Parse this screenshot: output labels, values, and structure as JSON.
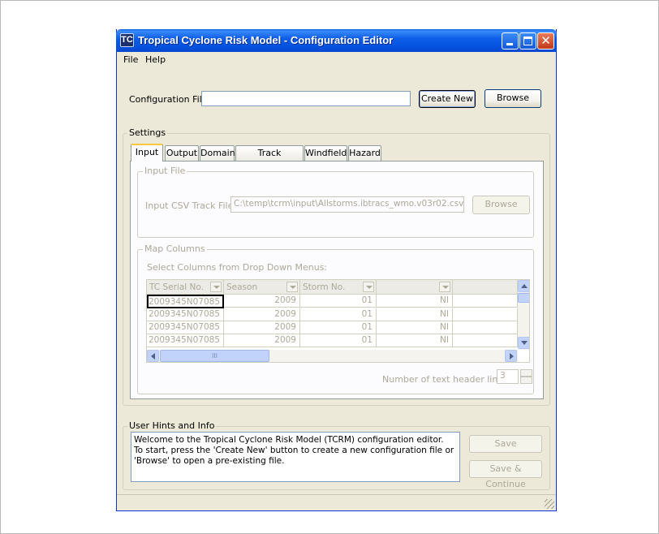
{
  "window": {
    "title": "Tropical Cyclone Risk Model - Configuration Editor",
    "icon_text": "TC"
  },
  "menu": [
    "File",
    "Help"
  ],
  "config": {
    "label": "Configuration File:",
    "value": "",
    "create_new_label": "Create New",
    "browse_label": "Browse"
  },
  "settings": {
    "title": "Settings",
    "tabs": [
      "Input",
      "Output",
      "Domain",
      "Track Generator",
      "Windfield",
      "Hazard"
    ],
    "active_tab": "Input",
    "input_file": {
      "title": "Input File",
      "label": "Input CSV Track File:",
      "value": "C:\\temp\\tcrm\\input\\Allstorms.ibtracs_wmo.v03r02.csv",
      "browse_label": "Browse"
    },
    "map_columns": {
      "title": "Map Columns",
      "instruction": "Select Columns from Drop Down Menus:",
      "headers": [
        "TC Serial No.",
        "Season",
        "Storm No.",
        "",
        ""
      ],
      "rows": [
        [
          "2009345N07085",
          "2009",
          "01",
          "NI",
          ""
        ],
        [
          "2009345N07085",
          "2009",
          "01",
          "NI",
          ""
        ],
        [
          "2009345N07085",
          "2009",
          "01",
          "NI",
          ""
        ],
        [
          "2009345N07085",
          "2009",
          "01",
          "NI",
          ""
        ]
      ],
      "hscroll_thumb_label": "III",
      "header_lines_label": "Number of text header lines:",
      "header_lines_value": "3"
    }
  },
  "hints": {
    "title": "User Hints and Info",
    "text_lines": [
      "Welcome to the Tropical Cyclone Risk Model (TCRM) configuration editor.",
      "To start, press the 'Create New' button to create a new configuration file or",
      "'Browse' to open a pre-existing file."
    ],
    "save_label": "Save",
    "save_continue_label": "Save & Continue"
  },
  "colors": {
    "titlebar": "#0555e0",
    "window_bg": "#ece9d8",
    "disabled_text": "#aca899",
    "tab_highlight": "#ffc83c"
  }
}
